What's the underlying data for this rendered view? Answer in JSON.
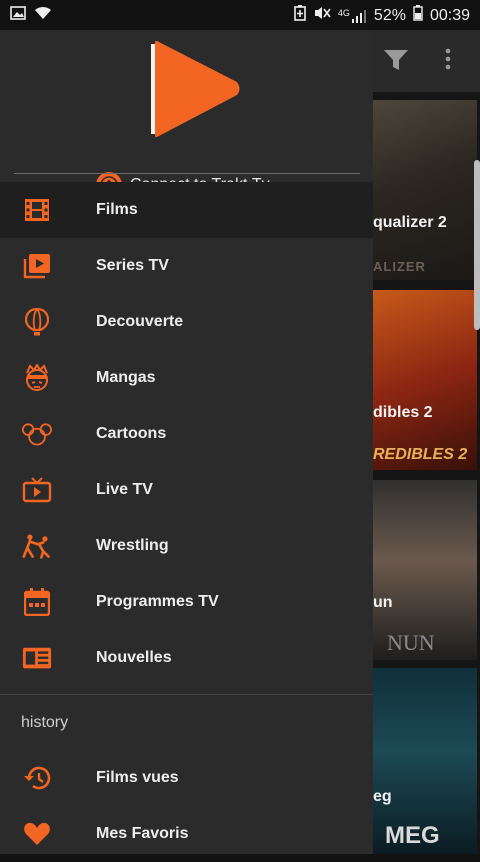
{
  "status_bar": {
    "left_icons": [
      "image-icon",
      "wifi-icon"
    ],
    "right_icons": [
      "battery-saver-icon",
      "mute-icon",
      "4g-signal-icon",
      "battery-icon"
    ],
    "network": "4G",
    "battery": "52%",
    "time": "00:39"
  },
  "background": {
    "toolbar_icons": [
      "filter-icon",
      "more-vert-icon"
    ],
    "posters": [
      {
        "label": "qualizer 2",
        "art_text": "ALIZER"
      },
      {
        "label": "dibles 2",
        "art_text": "REDIBLES 2"
      },
      {
        "label": "un",
        "art_text": "NUN"
      },
      {
        "label": "eg",
        "art_text": "MEG"
      }
    ]
  },
  "drawer": {
    "logo_icon": "play-logo-icon",
    "trakt_label": "Connect to Trakt.Tv",
    "trakt_icon": "trakt-icon",
    "menu": [
      {
        "label": "Films",
        "icon": "film-icon",
        "active": true
      },
      {
        "label": "Series TV",
        "icon": "video-library-icon",
        "active": false
      },
      {
        "label": "Decouverte",
        "icon": "balloon-icon",
        "active": false
      },
      {
        "label": "Mangas",
        "icon": "manga-face-icon",
        "active": false
      },
      {
        "label": "Cartoons",
        "icon": "mouse-ears-icon",
        "active": false
      },
      {
        "label": "Live TV",
        "icon": "live-tv-icon",
        "active": false
      },
      {
        "label": "Wrestling",
        "icon": "wrestling-icon",
        "active": false
      },
      {
        "label": "Programmes TV",
        "icon": "calendar-icon",
        "active": false
      },
      {
        "label": "Nouvelles",
        "icon": "news-icon",
        "active": false
      }
    ],
    "history_section": {
      "title": "history",
      "items": [
        {
          "label": "Films vues",
          "icon": "history-icon"
        },
        {
          "label": "Mes Favoris",
          "icon": "heart-icon"
        }
      ]
    }
  },
  "colors": {
    "accent": "#f26522",
    "drawer_bg": "#2b2b2b",
    "active_bg": "#1f1f1f",
    "text": "#ededed"
  }
}
